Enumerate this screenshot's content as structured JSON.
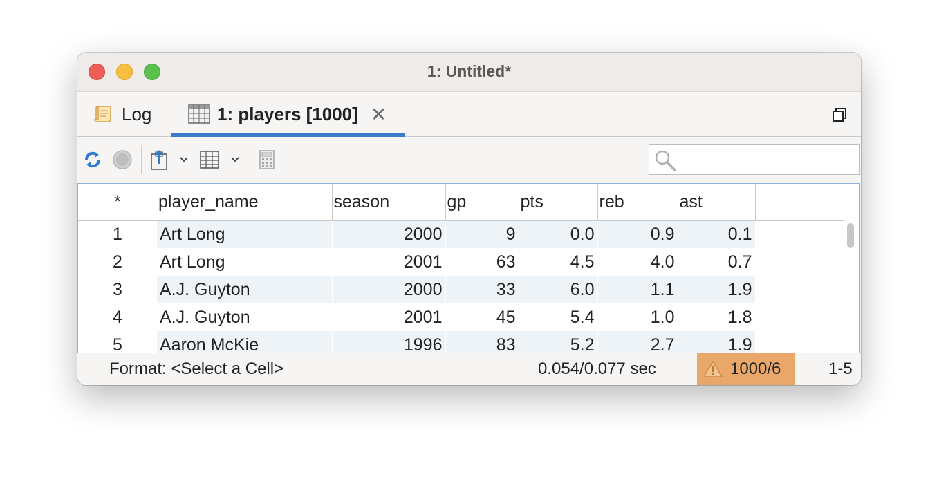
{
  "window": {
    "title": "1: Untitled*"
  },
  "tabs": {
    "log_label": "Log",
    "players_label": "1: players [1000]",
    "close_glyph": "✕"
  },
  "search": {
    "placeholder": ""
  },
  "grid": {
    "corner": "*",
    "columns": [
      "player_name",
      "season",
      "gp",
      "pts",
      "reb",
      "ast"
    ],
    "rows": [
      {
        "index": "1",
        "player_name": "Art Long",
        "season": "2000",
        "gp": "9",
        "pts": "0.0",
        "reb": "0.9",
        "ast": "0.1"
      },
      {
        "index": "2",
        "player_name": "Art Long",
        "season": "2001",
        "gp": "63",
        "pts": "4.5",
        "reb": "4.0",
        "ast": "0.7"
      },
      {
        "index": "3",
        "player_name": "A.J. Guyton",
        "season": "2000",
        "gp": "33",
        "pts": "6.0",
        "reb": "1.1",
        "ast": "1.9"
      },
      {
        "index": "4",
        "player_name": "A.J. Guyton",
        "season": "2001",
        "gp": "45",
        "pts": "5.4",
        "reb": "1.0",
        "ast": "1.8"
      },
      {
        "index": "5",
        "player_name": "Aaron McKie",
        "season": "1996",
        "gp": "83",
        "pts": "5.2",
        "reb": "2.7",
        "ast": "1.9"
      }
    ]
  },
  "status": {
    "format": "Format: <Select a Cell>",
    "timing": "0.054/0.077 sec",
    "dimensions": "1000/6",
    "range": "1-5"
  },
  "colors": {
    "accent": "#3a7dcb",
    "warning_badge": "#e9a86a",
    "row_alt": "#eef3f8"
  },
  "icons": [
    "log-icon",
    "table-icon",
    "close-icon",
    "restore-window-icon",
    "refresh-icon",
    "stop-icon",
    "export-icon",
    "chevron-down-icon",
    "table-view-icon",
    "calculator-icon",
    "search-icon",
    "warning-icon"
  ]
}
